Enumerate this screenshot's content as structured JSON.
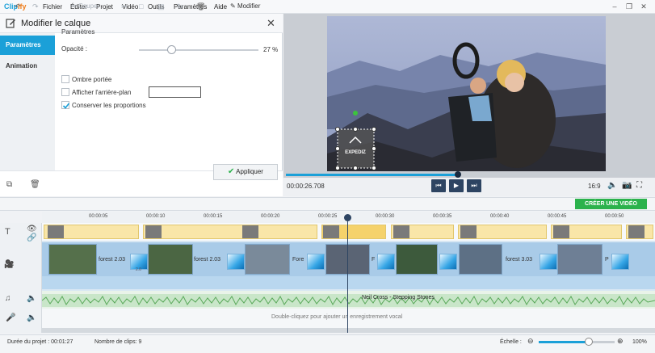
{
  "app": {
    "logo_a": "Clip",
    "logo_b": "ify"
  },
  "menu": [
    "Fichier",
    "Éditer",
    "Projet",
    "Vidéo",
    "Outils",
    "Paramètres",
    "Aide"
  ],
  "panel": {
    "title": "Modifier le calque",
    "tabs": {
      "params": "Paramètres",
      "animation": "Animation"
    },
    "section_title": "Paramètres",
    "opacity_label": "Opacité :",
    "opacity_value": "27 %",
    "opacity_fraction": 0.27,
    "checkboxes": {
      "shadow": "Ombre portée",
      "background": "Afficher l'arrière-plan",
      "proportions": "Conserver les proportions"
    },
    "apply_label": "Appliquer"
  },
  "preview": {
    "timecode": "00:00:26.708",
    "ratio": "16:9",
    "watermark": "EXPEDIZ"
  },
  "toolbar": {
    "cut": "Couper",
    "modify": "Modifier",
    "create": "CRÉER UNE VIDÉO"
  },
  "ruler": [
    "00:00:05",
    "00:00:10",
    "00:00:15",
    "00:00:20",
    "00:00:25",
    "00:00:30",
    "00:00:35",
    "00:00:40",
    "00:00:45",
    "00:00:50"
  ],
  "clips": {
    "c1": "forest 2.03",
    "c2": "forest 2.03",
    "c3": "Fore",
    "c4": "F",
    "c5": "forest 3.03",
    "c6": "P",
    "trans_val": "2.0"
  },
  "audio": {
    "track": "Neil Cross - Stepping Stones"
  },
  "voice": {
    "hint": "Double-cliquez pour ajouter un enregistrement vocal"
  },
  "status": {
    "duration": "Durée du projet :  00:01:27",
    "clips": "Nombre de clips: 9",
    "scale": "Échelle :",
    "zoom": "100%"
  },
  "colors": {
    "accent": "#1ba0d8",
    "create": "#2bb24c",
    "dark": "#2d4462"
  }
}
